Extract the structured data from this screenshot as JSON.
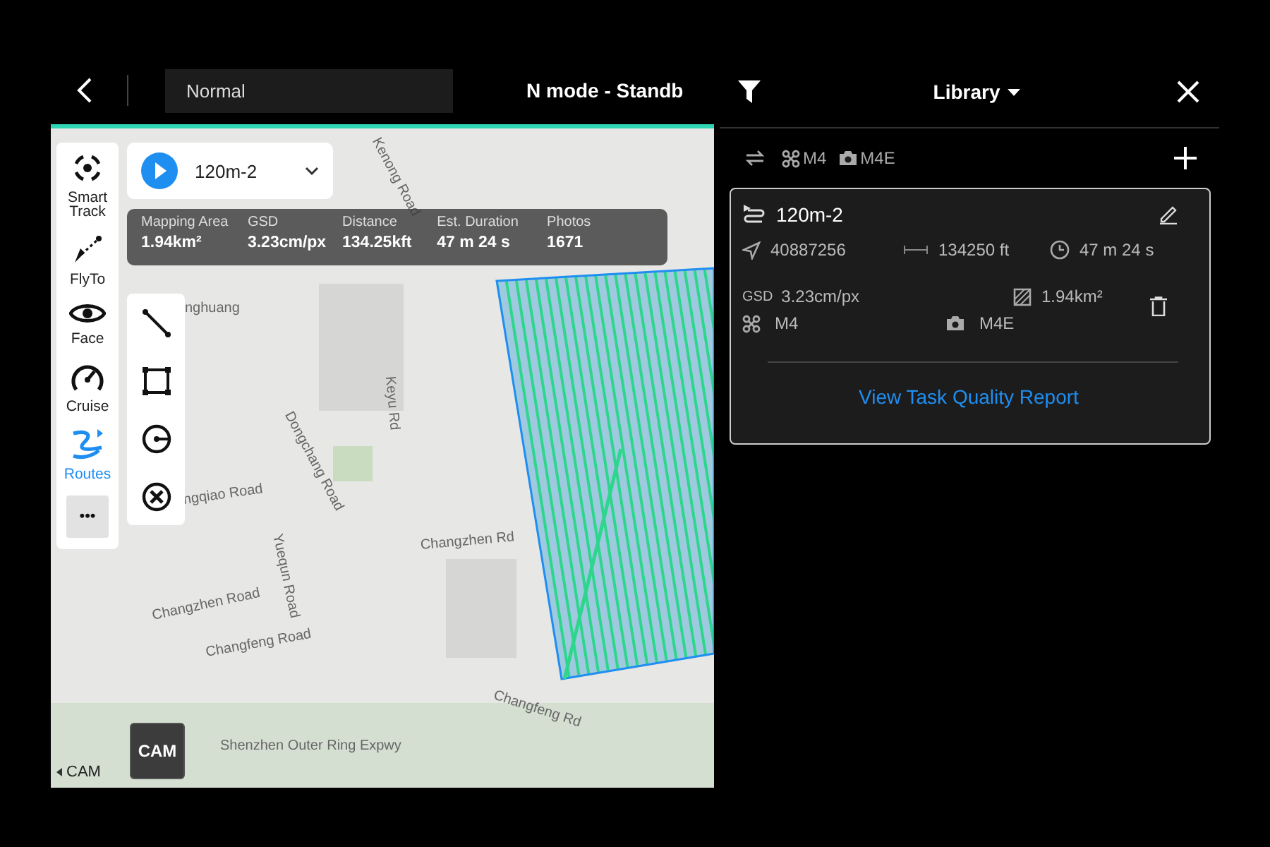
{
  "top_bar": {
    "mode_field": "Normal",
    "status": "N mode - Standb"
  },
  "sidebar": {
    "items": [
      {
        "label": "Smart Track",
        "kind": "track",
        "selected": false
      },
      {
        "label": "FlyTo",
        "kind": "flyto",
        "selected": false
      },
      {
        "label": "Face",
        "kind": "face",
        "selected": false
      },
      {
        "label": "Cruise",
        "kind": "cruise",
        "selected": false
      },
      {
        "label": "Routes",
        "kind": "routes",
        "selected": true
      }
    ],
    "more": "•••"
  },
  "route_selector": {
    "name": "120m-2"
  },
  "stats": [
    {
      "label": "Mapping Area",
      "value": "1.94km²"
    },
    {
      "label": "GSD",
      "value": "3.23cm/px"
    },
    {
      "label": "Distance",
      "value": "134.25kft"
    },
    {
      "label": "Est. Duration",
      "value": "47 m 24 s"
    },
    {
      "label": "Photos",
      "value": "1671"
    }
  ],
  "map_tools": [
    {
      "kind": "line"
    },
    {
      "kind": "rect"
    },
    {
      "kind": "circle"
    },
    {
      "kind": "cancel"
    }
  ],
  "map": {
    "labels": [
      "Kenong Road",
      "Keyu Rd",
      "Dongchang Road",
      "ngqiao Road",
      "Yuequn Road",
      "Changzhen Road",
      "Changfeng Road",
      "Changzhen Rd",
      "Changfeng Rd",
      "Shenzhen Outer Ring Expwy",
      "nghuang"
    ]
  },
  "cam_button": "CAM",
  "cam_label": "CAM",
  "library": {
    "title": "Library",
    "aircraft": "M4",
    "camera": "M4E",
    "mission": {
      "name": "120m-2",
      "waypoints": "40887256",
      "distance": "134250 ft",
      "duration": "47 m 24 s",
      "gsd_label": "GSD",
      "gsd": "3.23cm/px",
      "area": "1.94km²",
      "aircraft": "M4",
      "camera": "M4E",
      "link": "View Task Quality Report"
    }
  }
}
